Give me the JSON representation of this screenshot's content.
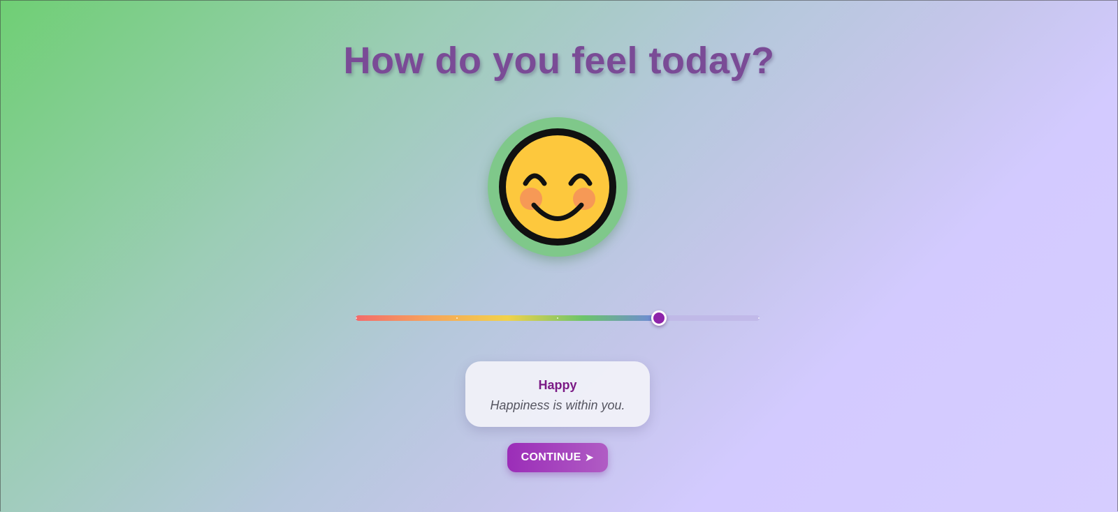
{
  "page": {
    "title": "How do you feel today?"
  },
  "emoji": {
    "icon": "smiling-face-with-smiling-eyes",
    "ring_color": "#7fc88a"
  },
  "mood_slider": {
    "value_fraction": 0.75,
    "fill_colors": [
      "#f36b6b",
      "#f6a55a",
      "#f2d24a",
      "#6cc46a",
      "#6e86de"
    ],
    "thumb_color": "#8e24aa"
  },
  "mood_card": {
    "label": "Happy",
    "quote": "Happiness is within you."
  },
  "continue_button": {
    "label": "CONTINUE",
    "icon": "send-arrow-icon",
    "glyph": "➤"
  },
  "colors": {
    "title": "#7a4b96",
    "accent": "#8e24aa",
    "mood_label": "#7b1a85"
  }
}
